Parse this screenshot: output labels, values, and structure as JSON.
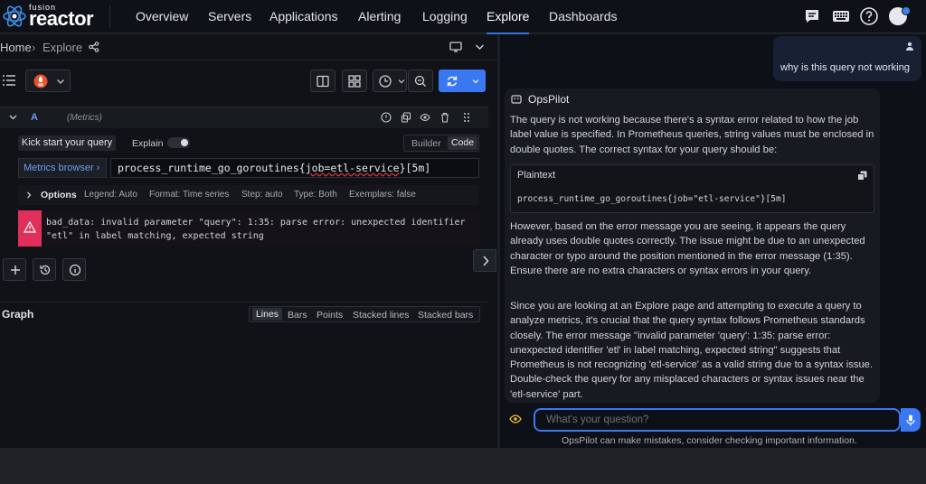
{
  "logo": {
    "small": "fusion",
    "big": "reactor"
  },
  "nav": [
    "Overview",
    "Servers",
    "Applications",
    "Alerting",
    "Logging",
    "Explore",
    "Dashboards"
  ],
  "breadcrumb": {
    "home": "Home",
    "sep": "›",
    "current": "Explore"
  },
  "query": {
    "letter": "A",
    "datasource_hint": "(Metrics)",
    "kick_start": "Kick start your query",
    "explain": "Explain",
    "builder": "Builder",
    "code": "Code",
    "metrics_browser": "Metrics browser ›",
    "expr_prefix": "process_runtime_go_goroutines{",
    "expr_label": "job=etl-service",
    "expr_suffix": "}[5m]",
    "options_label": "Options",
    "options": [
      "Legend: Auto",
      "Format: Time series",
      "Step: auto",
      "Type: Both",
      "Exemplars: false"
    ],
    "error_line1": "bad_data: invalid parameter \"query\": 1:35: parse error: unexpected identifier",
    "error_line2": "\"etl\" in label matching, expected string"
  },
  "graph": {
    "title": "Graph",
    "modes": [
      "Lines",
      "Bars",
      "Points",
      "Stacked lines",
      "Stacked bars"
    ],
    "active_mode": "Lines"
  },
  "chat": {
    "user_message": "why is this query not working",
    "assistant_name": "OpsPilot",
    "p1": "The query is not working because there's a syntax error related to how the job label value is specified. In Prometheus queries, string values must be enclosed in double quotes. The correct syntax for your query should be:",
    "code_lang": "Plaintext",
    "code": "process_runtime_go_goroutines{job=\"etl-service\"}[5m]",
    "p2": "However, based on the error message you are seeing, it appears the query already uses double quotes correctly. The issue might be due to an unexpected character or typo around the position mentioned in the error message (1:35). Ensure there are no extra characters or syntax errors in your query.",
    "p3": "Since you are looking at an Explore page and attempting to execute a query to analyze metrics, it's crucial that the query syntax follows Prometheus standards closely. The error message \"invalid parameter 'query': 1:35: parse error: unexpected identifier 'etl' in label matching, expected string\" suggests that Prometheus is not recognizing 'etl-service' as a valid string due to a syntax issue. Double-check the query for any misplaced characters or syntax issues near the 'etl-service' part.",
    "input_placeholder": "What's your question?",
    "disclaimer": "OpsPilot can make mistakes, consider checking important information."
  },
  "colors": {
    "accent": "#3a78f2",
    "error": "#e02f5b",
    "prometheus": "#e6522c"
  }
}
